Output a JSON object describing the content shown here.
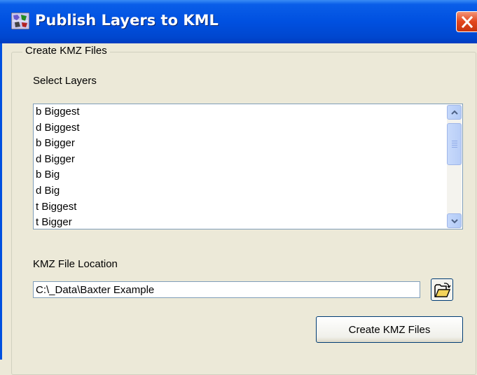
{
  "window": {
    "title": "Publish Layers to KML",
    "icon": "map-globe-icon",
    "close_icon": "close-icon",
    "accent_color": "#0050e0",
    "close_color": "#e2461d"
  },
  "group": {
    "legend": "Create KMZ Files"
  },
  "layers": {
    "label": "Select Layers",
    "items": [
      "b Biggest",
      "d Biggest",
      "b Bigger",
      "d Bigger",
      "b Big",
      "d Big",
      "t Biggest",
      "t Bigger"
    ]
  },
  "location": {
    "label": "KMZ File Location",
    "value": "C:\\_Data\\Baxter Example",
    "browse_icon": "open-folder-icon"
  },
  "actions": {
    "create_label": "Create KMZ Files"
  }
}
